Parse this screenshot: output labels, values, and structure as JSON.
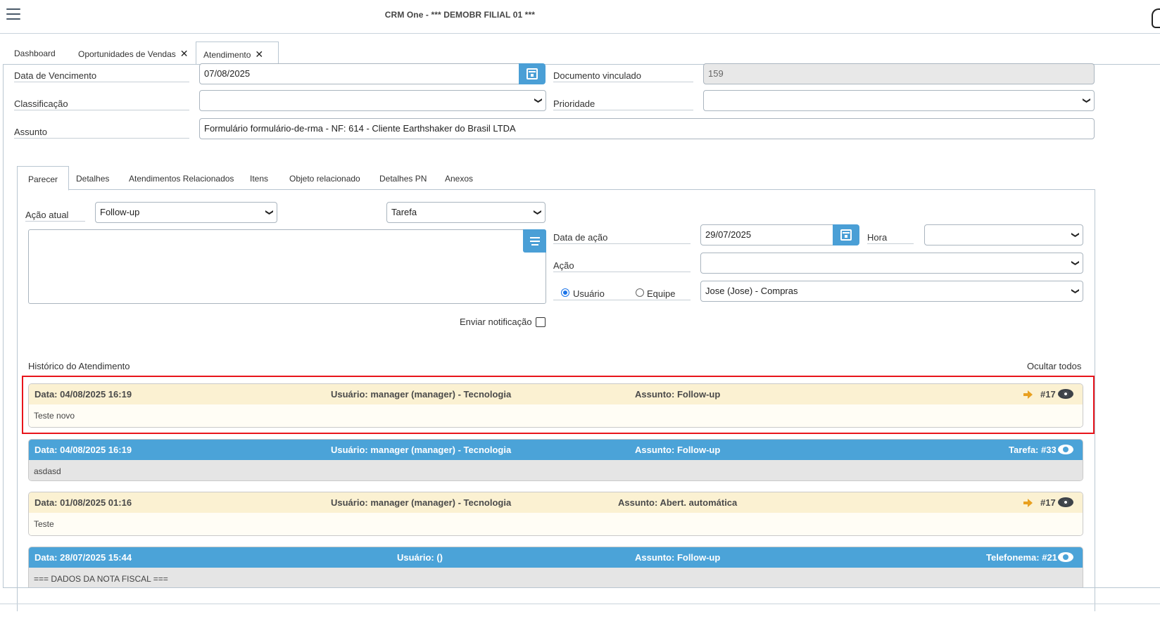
{
  "app": {
    "title": "CRM One - *** DEMOBR FILIAL 01 ***"
  },
  "tabs": [
    {
      "label": "Dashboard",
      "closable": false
    },
    {
      "label": "Oportunidades de Vendas",
      "closable": true
    },
    {
      "label": "Atendimento",
      "closable": true,
      "active": true
    }
  ],
  "form": {
    "vencimento_label": "Data de Vencimento",
    "vencimento_value": "07/08/2025",
    "documento_label": "Documento vinculado",
    "documento_value": "159",
    "classificacao_label": "Classificação",
    "classificacao_value": "",
    "prioridade_label": "Prioridade",
    "prioridade_value": "",
    "assunto_label": "Assunto",
    "assunto_value": "Formulário formulário-de-rma - NF: 614 - Cliente Earthshaker do Brasil LTDA"
  },
  "inner_tabs": [
    "Parecer",
    "Detalhes",
    "Atendimentos Relacionados",
    "Itens",
    "Objeto relacionado",
    "Detalhes PN",
    "Anexos"
  ],
  "parecer": {
    "acao_atual_label": "Ação atual",
    "acao_atual_value": "Follow-up",
    "tipo_value": "Tarefa",
    "data_acao_label": "Data de ação",
    "data_acao_value": "29/07/2025",
    "hora_label": "Hora",
    "hora_value": "",
    "acao_label": "Ação",
    "acao_value": "",
    "usuario_label": "Usuário",
    "equipe_label": "Equipe",
    "responsavel_value": "Jose (Jose) - Compras",
    "notificacao_label": "Enviar notificação"
  },
  "historico": {
    "title": "Histórico do Atendimento",
    "toggle_label": "Ocultar todos",
    "entries": [
      {
        "style": "yellow",
        "data": "Data: 04/08/2025 16:19",
        "usuario": "Usuário: manager (manager) - Tecnologia",
        "assunto": "Assunto: Follow-up",
        "ref": "#17",
        "body": "Teste novo"
      },
      {
        "style": "blue",
        "data": "Data: 04/08/2025 16:19",
        "usuario": "Usuário: manager (manager) - Tecnologia",
        "assunto": "Assunto: Follow-up",
        "ref": "Tarefa: #33",
        "body": "asdasd"
      },
      {
        "style": "yellow",
        "data": "Data: 01/08/2025 01:16",
        "usuario": "Usuário: manager (manager) - Tecnologia",
        "assunto": "Assunto: Abert. automática",
        "ref": "#17",
        "body": "Teste"
      },
      {
        "style": "blue",
        "data": "Data: 28/07/2025 15:44",
        "usuario": "Usuário: ()",
        "assunto": "Assunto: Follow-up",
        "ref": "Telefonema: #21",
        "body": "=== DADOS DA NOTA FISCAL ==="
      }
    ]
  },
  "colors": {
    "accent": "#4a9fd6",
    "highlight": "#e8141b",
    "yellow_row": "#fbf1d2",
    "blue_row": "#4ba3d8"
  }
}
